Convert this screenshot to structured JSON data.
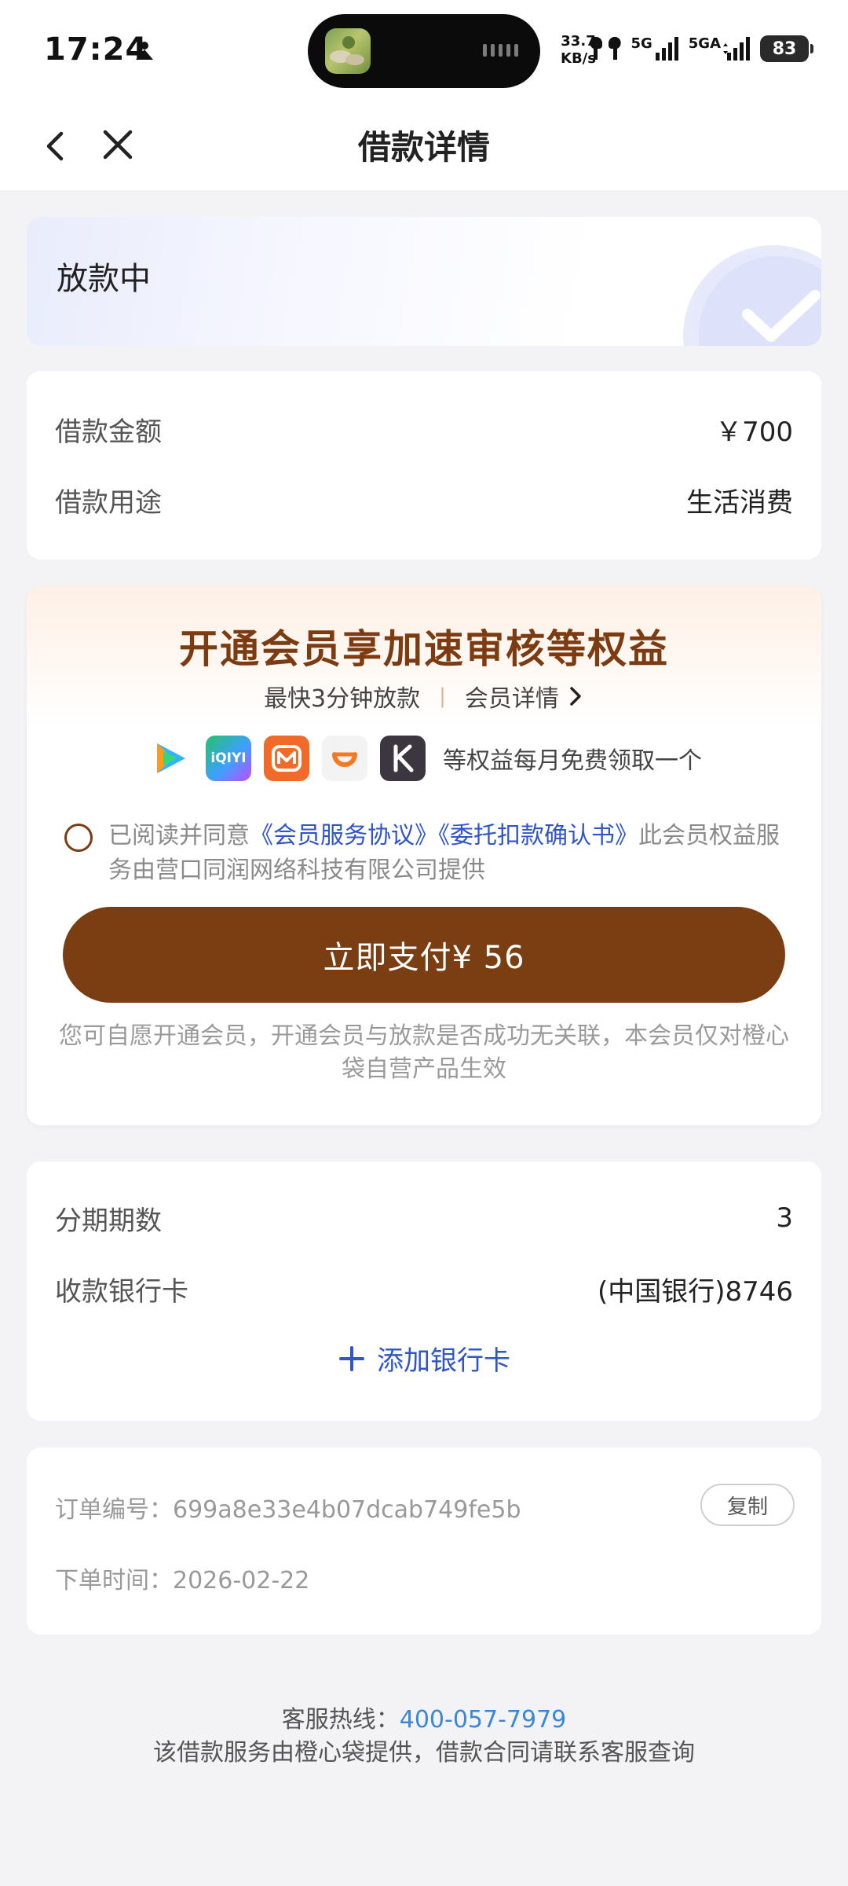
{
  "status_bar": {
    "time": "17:24",
    "speed_value": "33.7",
    "speed_unit": "KB/s",
    "net1": "5G",
    "net2": "5GA",
    "battery": "83"
  },
  "nav": {
    "title": "借款详情",
    "back_icon": "chevron-left-icon",
    "close_icon": "close-icon"
  },
  "status_card": {
    "status": "放款中"
  },
  "loan": {
    "amount_label": "借款金额",
    "amount_value": "￥700",
    "purpose_label": "借款用途",
    "purpose_value": "生活消费"
  },
  "member": {
    "title": "开通会员享加速审核等权益",
    "speed_text": "最快3分钟放款",
    "separator": "|",
    "details_text": "会员详情",
    "app_icons": [
      "tencent-video-icon",
      "iqiyi-icon",
      "mango-tv-icon",
      "didi-icon",
      "kuaikan-icon"
    ],
    "iqiyi_logo_text": "iQIYI",
    "benefit_text": "等权益每月免费领取一个",
    "agree_prefix": "已阅读并同意",
    "agreement_1": "《会员服务协议》",
    "agreement_2": "《委托扣款确认书》",
    "agree_suffix": "此会员权益服务由营口同润网络科技有限公司提供",
    "pay_button": "立即支付¥ 56",
    "note": "您可自愿开通会员，开通会员与放款是否成功无关联，本会员仅对橙心袋自营产品生效",
    "accent_color": "#7a3e12"
  },
  "installment": {
    "periods_label": "分期期数",
    "periods_value": "3",
    "bank_label": "收款银行卡",
    "bank_value": "(中国银行)8746",
    "add_card": "添加银行卡"
  },
  "order": {
    "number_label": "订单编号：",
    "number_value": "699a8e33e4b07dcab749fe5b",
    "copy_button": "复制",
    "time_label": "下单时间：",
    "time_value": "2026-02-22"
  },
  "footer": {
    "hotline_label": "客服热线：",
    "hotline_number": "400-057-7979",
    "notice": "该借款服务由橙心袋提供，借款合同请联系客服查询"
  }
}
